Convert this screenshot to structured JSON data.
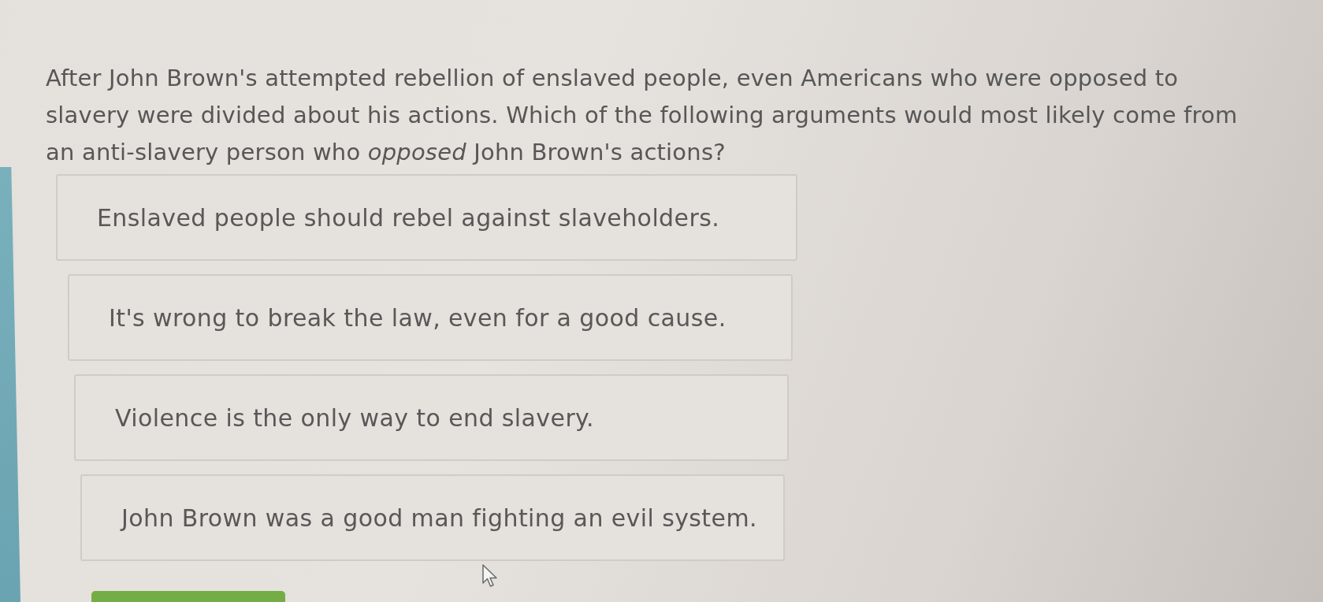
{
  "question": {
    "text": "After John Brown's attempted rebellion of enslaved people, even Americans who were opposed to slavery were divided about his actions. Which of the following arguments would most likely come from an anti-slavery person who *opposed* John Brown's actions?"
  },
  "choices": [
    {
      "text": "Enslaved people should rebel against slaveholders.",
      "selected": false
    },
    {
      "text": "It's wrong to break the law, even for a good cause.",
      "selected": false
    },
    {
      "text": "Violence is the only way to end slavery.",
      "selected": false
    },
    {
      "text": "John Brown was a good man fighting an evil system.",
      "selected": false
    }
  ],
  "button": {
    "kind": "primary"
  }
}
